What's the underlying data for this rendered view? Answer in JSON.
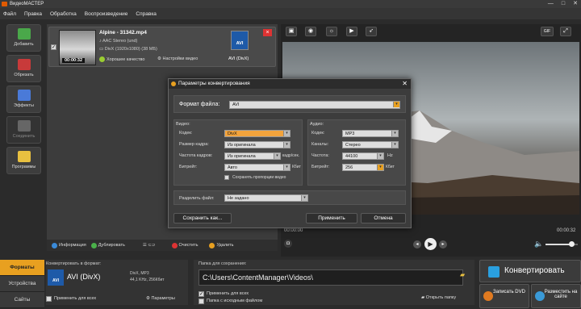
{
  "window": {
    "title": "ВидеоМАСТЕР",
    "controls": [
      "—",
      "□",
      "✕"
    ]
  },
  "menu": [
    "Файл",
    "Правка",
    "Обработка",
    "Воспроизведение",
    "Справка"
  ],
  "tools": [
    {
      "label": "Добавить",
      "icon": "add-file-icon"
    },
    {
      "label": "Обрезать",
      "icon": "cut-icon"
    },
    {
      "label": "Эффекты",
      "icon": "effects-icon"
    },
    {
      "label": "Соединить",
      "icon": "join-icon"
    },
    {
      "label": "Программы",
      "icon": "programs-icon"
    }
  ],
  "file": {
    "name": "Alpine - 31342.mp4",
    "duration": "00:00:32",
    "audio": "AAC Stereo (und)",
    "video": "DivX (1920x1080) (38 МБ)",
    "quality": "Хорошее качество",
    "settings": "Настройки видео",
    "format_badge": "AVI",
    "format_label": "AVI (DivX)"
  },
  "bottom_toolbar": {
    "info": "Информация",
    "duplicate": "Дублировать",
    "clear": "Очистить",
    "delete": "Удалить"
  },
  "player": {
    "time_start": "00:00:00",
    "time_end": "00:00:32",
    "volume_fraction": 0.8
  },
  "dialog": {
    "title": "Параметры конвертирования",
    "format_label": "Формат файла:",
    "format_value": "AVI",
    "video_header": "Видео:",
    "audio_header": "Аудио:",
    "codec_label": "Кодек:",
    "video_codec": "DivX",
    "frame_label": "Размер кадра:",
    "frame_value": "Из оригинала",
    "fps_label": "Частота кадров:",
    "fps_value": "Из оригинала",
    "fps_unit": "кадр/сек.",
    "bitrate_label": "Битрейт:",
    "bitrate_value": "Авто",
    "bitrate_unit": "Кбит",
    "keep_aspect": "Сохранять пропорции видео",
    "audio_codec_label": "Кодек:",
    "audio_codec": "MP3",
    "channels_label": "Каналы:",
    "channels": "Стерео",
    "freq_label": "Частота:",
    "freq": "44100",
    "freq_unit": "Hz",
    "abitrate_label": "Битрейт:",
    "abitrate": "256",
    "abitrate_unit": "Кбит",
    "split_label": "Разделить файл:",
    "split_value": "Не задано",
    "save_as": "Сохранить как...",
    "apply": "Применить",
    "cancel": "Отмена"
  },
  "footer": {
    "tabs": [
      "Форматы",
      "Устройства",
      "Сайты"
    ],
    "convert_to_label": "Конвертировать в формат:",
    "format_name": "AVI (DivX)",
    "format_badge": "AVI",
    "format_details_1": "DivX, MP3",
    "format_details_2": "44,1 KHz, 256Кбит",
    "apply_all": "Применить для всех",
    "params": "Параметры",
    "save_folder_label": "Папка для сохранения:",
    "save_path": "C:\\Users\\ContentManager\\Videos\\",
    "apply_all_2": "Применить для всех",
    "source_folder": "Папка с исходным файлом",
    "open_folder": "Открыть папку",
    "convert": "Конвертировать",
    "dvd": "Записать DVD",
    "web": "Разместить на сайте"
  }
}
